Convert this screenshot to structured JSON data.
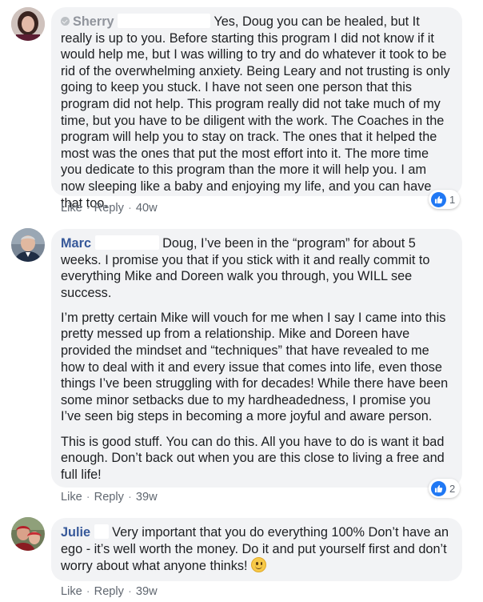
{
  "comments": [
    {
      "author": "Sherry",
      "text_after_name": "Yes, Doug you can be healed, but It really is up to you. Before starting this program I did not know if it would help me, but I was willing to try and do whatever it took to be rid of the overwhelming anxiety. Being Leary and not trusting is only going to keep you stuck. I have not seen one person that this program did not help. This program really did not take much of my time, but you have to be diligent with the work. The Coaches in the program will help you to stay on track. The ones that it helped the most was the ones that put the most effort into it. The more time you dedicate to this program than the more it will help you. I am now sleeping like a baby and enjoying my life, and you can have that too.",
      "like_label": "Like",
      "reply_label": "Reply",
      "separator": "·",
      "time": "40w",
      "reaction_count": "1",
      "avatar_icon": "user-avatar-icon"
    },
    {
      "author": "Marc",
      "paragraphs": [
        "Doug, I’ve been in the “program” for about 5 weeks. I promise you that if you stick with it and really commit to everything Mike and Doreen walk you through, you WILL see success.",
        "I’m pretty certain Mike will vouch for me when I say I came into this pretty messed up from a relationship. Mike and Doreen have provided the mindset and “techniques” that have revealed to me how to deal with it and every issue that comes into life, even those things I’ve been struggling with for decades! While there have been some minor setbacks due to my hardheadedness, I promise you I’ve seen big steps in becoming a more joyful and aware person.",
        "This is good stuff. You can do this. All you have to do is want it bad enough. Don’t back out when you are this close to living a free and full life!"
      ],
      "like_label": "Like",
      "reply_label": "Reply",
      "separator": "·",
      "time": "39w",
      "reaction_count": "2",
      "avatar_icon": "user-avatar-icon"
    },
    {
      "author": "Julie",
      "text_after_name": "Very important that you do everything 100% Don’t have an ego - it’s well worth the money. Do it and put yourself first and don’t worry about what anyone thinks!",
      "emoji_icon": "smiley-emoji-icon",
      "like_label": "Like",
      "reply_label": "Reply",
      "separator": "·",
      "time": "39w",
      "avatar_icon": "user-avatar-icon"
    }
  ],
  "colors": {
    "bubble_bg": "#f2f3f5",
    "author_link": "#365899",
    "action_text": "#606770",
    "like_blue": "#2078f4"
  }
}
